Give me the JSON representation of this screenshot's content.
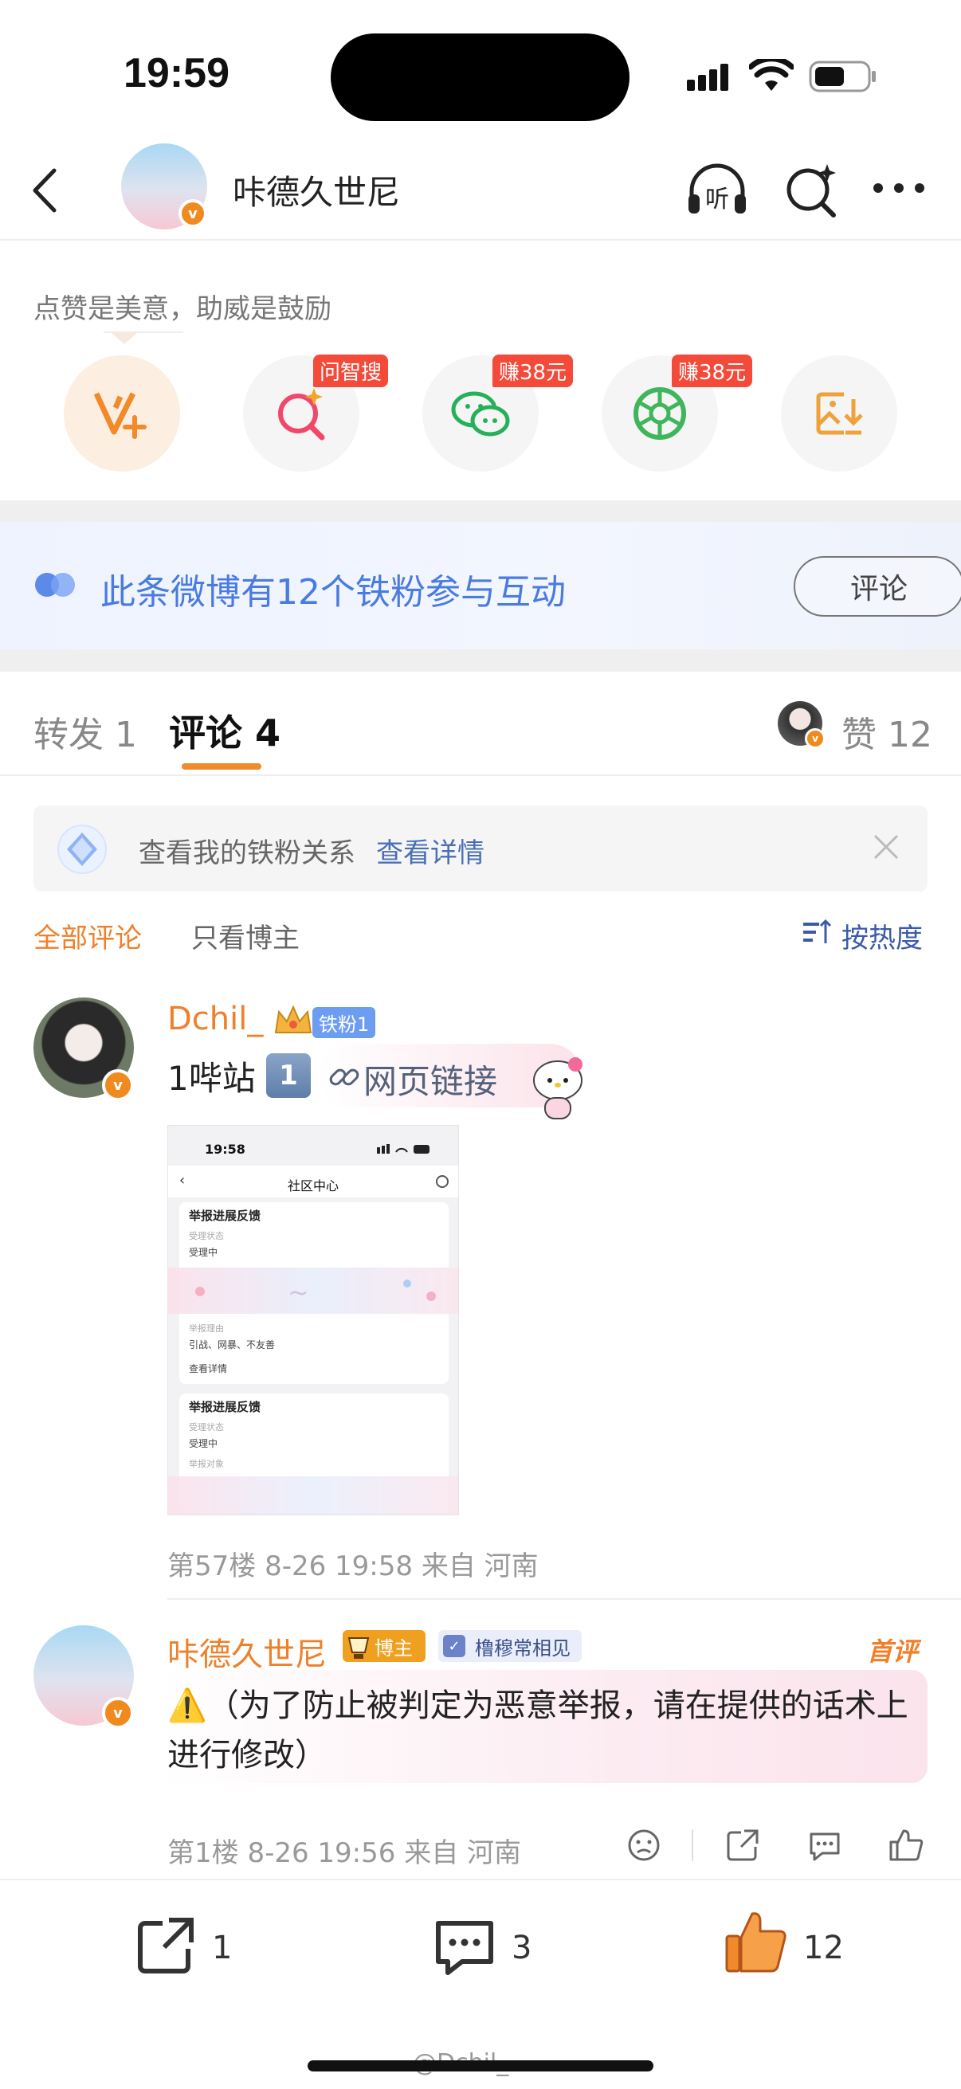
{
  "status": {
    "time": "19:59"
  },
  "header": {
    "title": "咔德久世尼"
  },
  "support": {
    "tagline": "点赞是美意，助威是鼓励",
    "actions": [
      {
        "icon": "v-plus-icon",
        "tag": ""
      },
      {
        "icon": "ai-search-icon",
        "tag": "问智搜"
      },
      {
        "icon": "wechat-icon",
        "tag": "赚38元"
      },
      {
        "icon": "moments-icon",
        "tag": "赚38元"
      },
      {
        "icon": "save-image-icon",
        "tag": ""
      }
    ]
  },
  "banner": {
    "text": "此条微博有12个铁粉参与互动",
    "button": "评论"
  },
  "tabs": {
    "repost": "转发 1",
    "comment": "评论 4",
    "like": "赞 12"
  },
  "fanbar": {
    "text": "查看我的铁粉关系",
    "link": "查看详情"
  },
  "filters": {
    "all": "全部评论",
    "author_only": "只看博主",
    "sort": "按热度"
  },
  "comments": [
    {
      "user": "Dchil_",
      "badge": "铁粉1",
      "text": "1哔站",
      "num_emoji": "1",
      "link_text": "网页链接",
      "meta": "第57楼 8-26 19:58 来自 河南",
      "screenshot": {
        "time": "19:58",
        "title": "社区中心",
        "card1_title": "举报进展反馈",
        "card1_l1": "受理状态",
        "card1_l2": "受理中",
        "card1_l3": "举报理由",
        "card1_l4": "引战、网暴、不友善",
        "card1_more": "查看详情",
        "card2_title": "举报进展反馈",
        "card2_l1": "受理状态",
        "card2_l2": "受理中",
        "card2_l3": "举报对象"
      }
    },
    {
      "user": "咔德久世尼",
      "badge": "博主",
      "badge2": "橹穆常相见",
      "first_tag": "首评",
      "text": "⚠️（为了防止被判定为恶意举报，请在提供的话术上进行修改）",
      "meta": "第1楼 8-26 19:56 来自 河南"
    }
  ],
  "bottom": {
    "repost": "1",
    "comment": "3",
    "like": "12"
  },
  "watermark": "@Dchil_",
  "colors": {
    "accent": "#f07f2a",
    "link": "#4a6fb5",
    "red_tag": "#f44a3a"
  }
}
